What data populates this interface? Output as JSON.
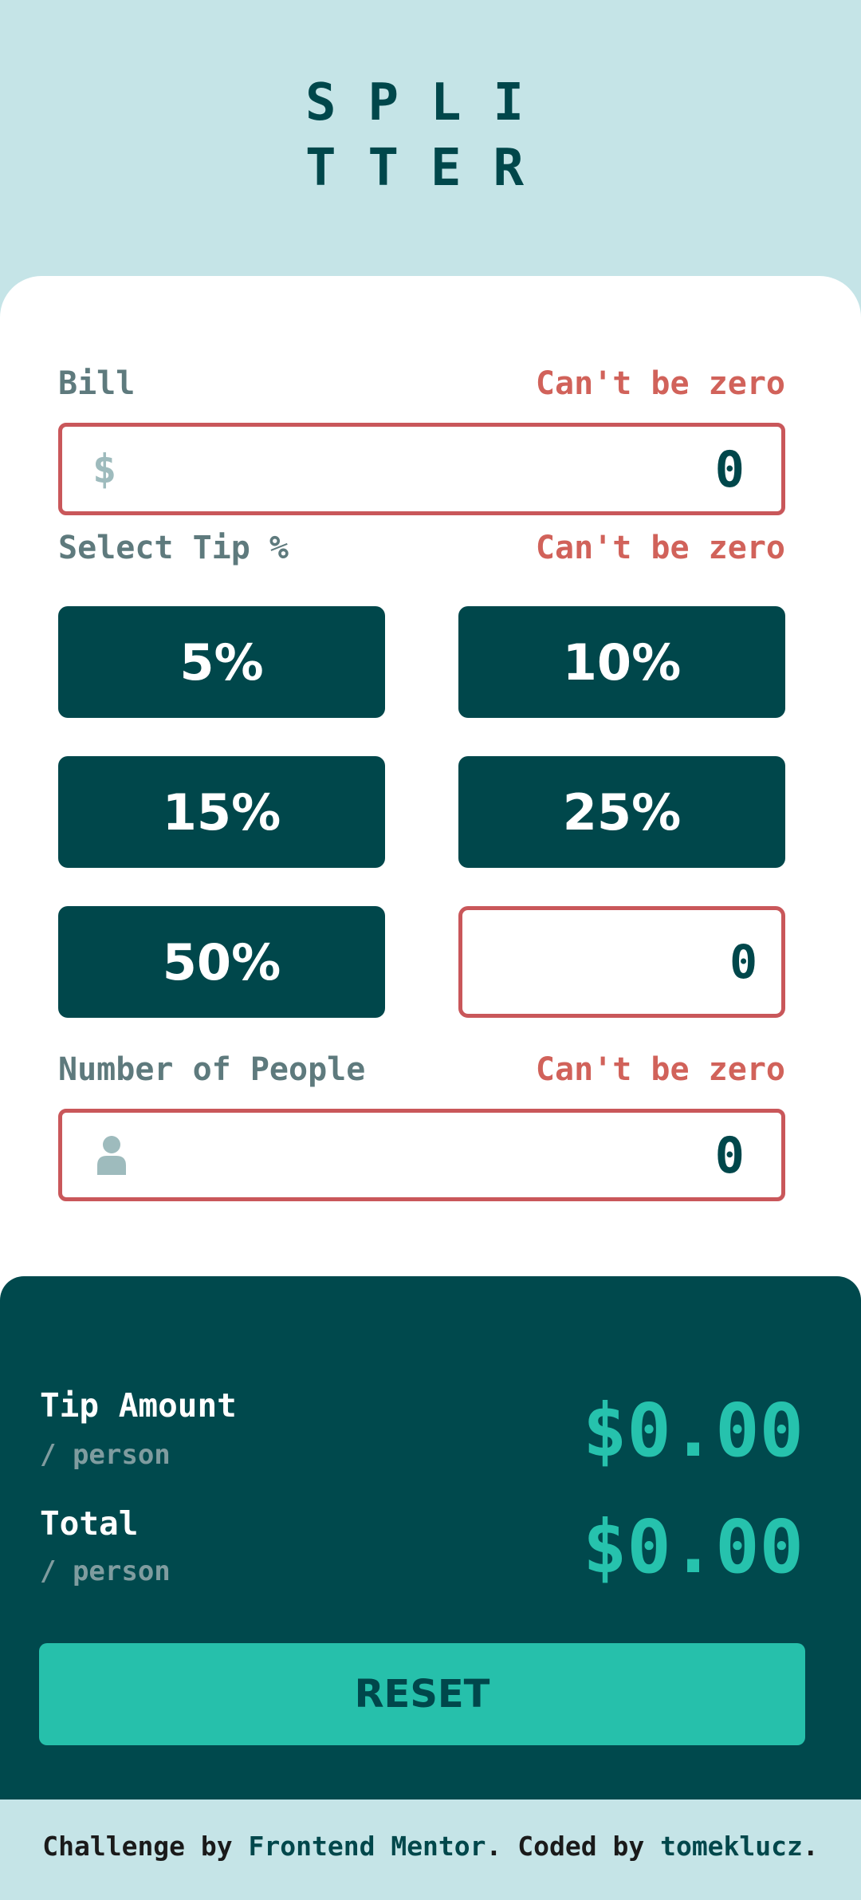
{
  "logo": {
    "line1": "SPLI",
    "line2": "TTER"
  },
  "bill": {
    "label": "Bill",
    "error": "Can't be zero",
    "currency": "$",
    "value": "0"
  },
  "tip": {
    "label": "Select Tip %",
    "error": "Can't be zero",
    "options": [
      "5%",
      "10%",
      "15%",
      "25%",
      "50%"
    ],
    "custom_value": "0"
  },
  "people": {
    "label": "Number of People",
    "error": "Can't be zero",
    "icon": "person-icon",
    "value": "0"
  },
  "results": {
    "tip_title": "Tip Amount",
    "tip_sub": "/ person",
    "tip_value": "$0.00",
    "total_title": "Total",
    "total_sub": "/ person",
    "total_value": "$0.00",
    "reset_label": "RESET"
  },
  "footer": {
    "prefix": "Challenge by ",
    "link1": "Frontend Mentor",
    "middle": ". Coded by ",
    "link2": "tomeklucz",
    "suffix": "."
  },
  "colors": {
    "background": "#c5e4e7",
    "dark_teal": "#00474b",
    "accent": "#26c2ad",
    "error": "#d1625a"
  }
}
